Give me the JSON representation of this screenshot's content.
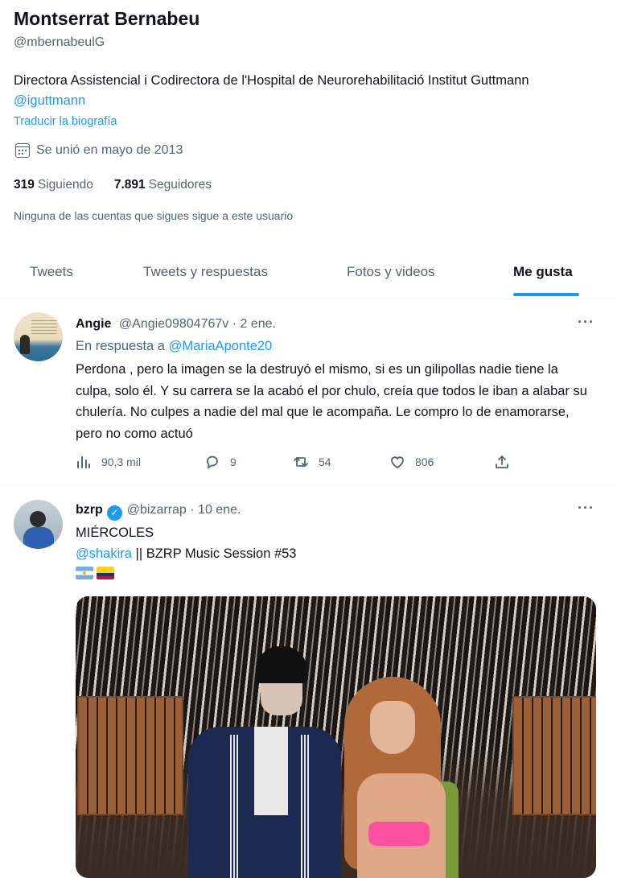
{
  "profile": {
    "name": "Montserrat Bernabeu",
    "handle": "@mbernabeulG",
    "bio_text": "Directora Assistencial i Codirectora de l'Hospital de Neurorehabilitació Institut Guttmann",
    "bio_mention": "@iguttmann",
    "translate_label": "Traducir la biografía",
    "joined_icon": "calendar-icon",
    "joined": "Se unió en mayo de 2013",
    "following_count": "319",
    "following_label": "Siguiendo",
    "followers_count": "7.891",
    "followers_label": "Seguidores",
    "mutual_note": "Ninguna de las cuentas que sigues sigue a este usuario"
  },
  "tabs": [
    {
      "label": "Tweets",
      "active": false
    },
    {
      "label": "Tweets y respuestas",
      "active": false
    },
    {
      "label": "Fotos y videos",
      "active": false
    },
    {
      "label": "Me gusta",
      "active": true
    }
  ],
  "accent_color": "#1d9bf0",
  "tweets": [
    {
      "author": "Angie",
      "handle": "@Angie09804767v",
      "date": "· 2 ene.",
      "reply_prefix": "En respuesta a",
      "reply_to": "@MariaAponte20",
      "text": "Perdona , pero la imagen se la destruyó el mismo, si es un gilipollas nadie tiene la culpa, solo él. Y su carrera se la acabó el por chulo, creía que todos le iban a alabar su chulería. No culpes a nadie del mal que le acompaña. Le compro lo de enamorarse, pero no como actuó",
      "views": "90,3 mil",
      "replies": "9",
      "retweets": "54",
      "likes": "806",
      "more": "···"
    },
    {
      "author": "bzrp",
      "verified": true,
      "handle": "@bizarrap",
      "date": "· 10 ene.",
      "line1": "MIÉRCOLES",
      "mention": "@shakira",
      "line2": "|| BZRP Music Session #53",
      "flags": [
        "argentina-flag",
        "colombia-flag"
      ],
      "more": "···"
    }
  ]
}
